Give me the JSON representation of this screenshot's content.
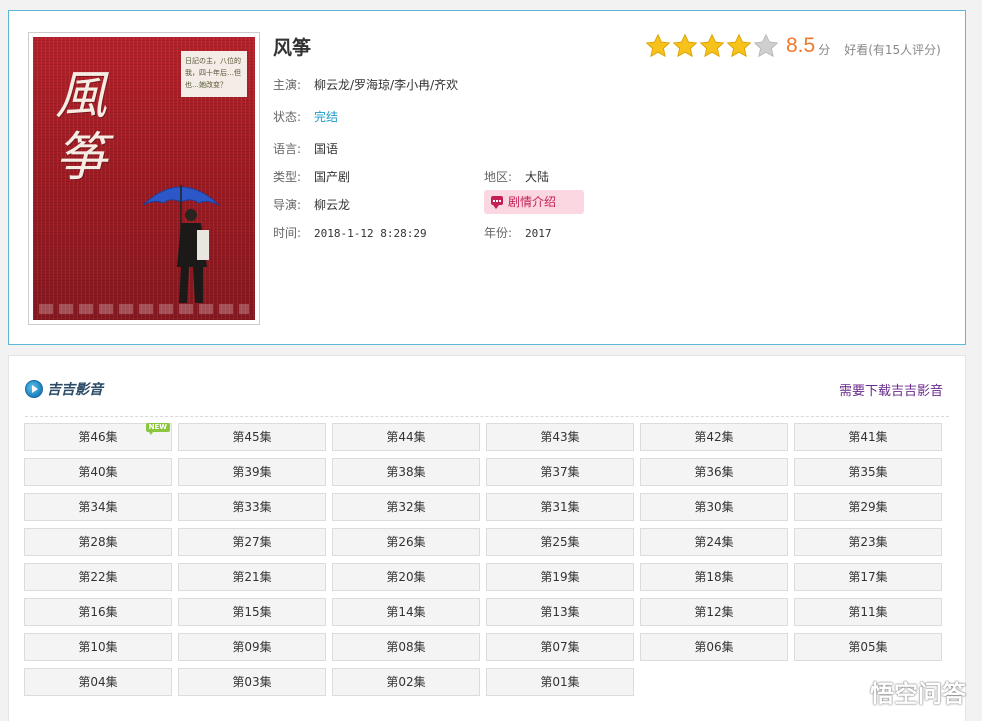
{
  "detail": {
    "title": "风筝",
    "poster": {
      "title": "風筝",
      "tagline": "日記の主，八位的我，四十年后…但也…她改变？"
    },
    "cast": {
      "label": "主演:",
      "value": "柳云龙/罗海琼/李小冉/齐欢"
    },
    "status": {
      "label": "状态:",
      "value": "完结"
    },
    "language": {
      "label": "语言:",
      "value": "国语"
    },
    "genre": {
      "label": "类型:",
      "value": "国产剧"
    },
    "region": {
      "label": "地区:",
      "value": "大陆"
    },
    "director": {
      "label": "导演:",
      "value": "柳云龙"
    },
    "plot_button": "剧情介绍",
    "time": {
      "label": "时间:",
      "value": "2018-1-12 8:28:29"
    },
    "year": {
      "label": "年份:",
      "value": "2017"
    },
    "rating": {
      "score": "8.5",
      "unit": "分",
      "desc": "好看(有15人评分)",
      "stars_total": 5,
      "stars_filled": 4
    }
  },
  "episodes": {
    "brand": "吉吉影音",
    "download_link": "需要下载吉吉影音",
    "new_badge": "NEW",
    "items": [
      "第46集",
      "第45集",
      "第44集",
      "第43集",
      "第42集",
      "第41集",
      "第40集",
      "第39集",
      "第38集",
      "第37集",
      "第36集",
      "第35集",
      "第34集",
      "第33集",
      "第32集",
      "第31集",
      "第30集",
      "第29集",
      "第28集",
      "第27集",
      "第26集",
      "第25集",
      "第24集",
      "第23集",
      "第22集",
      "第21集",
      "第20集",
      "第19集",
      "第18集",
      "第17集",
      "第16集",
      "第15集",
      "第14集",
      "第13集",
      "第12集",
      "第11集",
      "第10集",
      "第09集",
      "第08集",
      "第07集",
      "第06集",
      "第05集",
      "第04集",
      "第03集",
      "第02集",
      "第01集"
    ]
  },
  "watermark": "悟空问答",
  "colors": {
    "accent": "#5bb8d6",
    "score": "#f0782a",
    "star": "#f7c21b",
    "star_empty": "#cfcfcf",
    "status_link": "#1c9bc8",
    "plot_button_bg": "#fad7e1",
    "plot_button_text": "#c41f55",
    "download_link": "#6a2a8a",
    "new_badge": "#8cc63f"
  }
}
